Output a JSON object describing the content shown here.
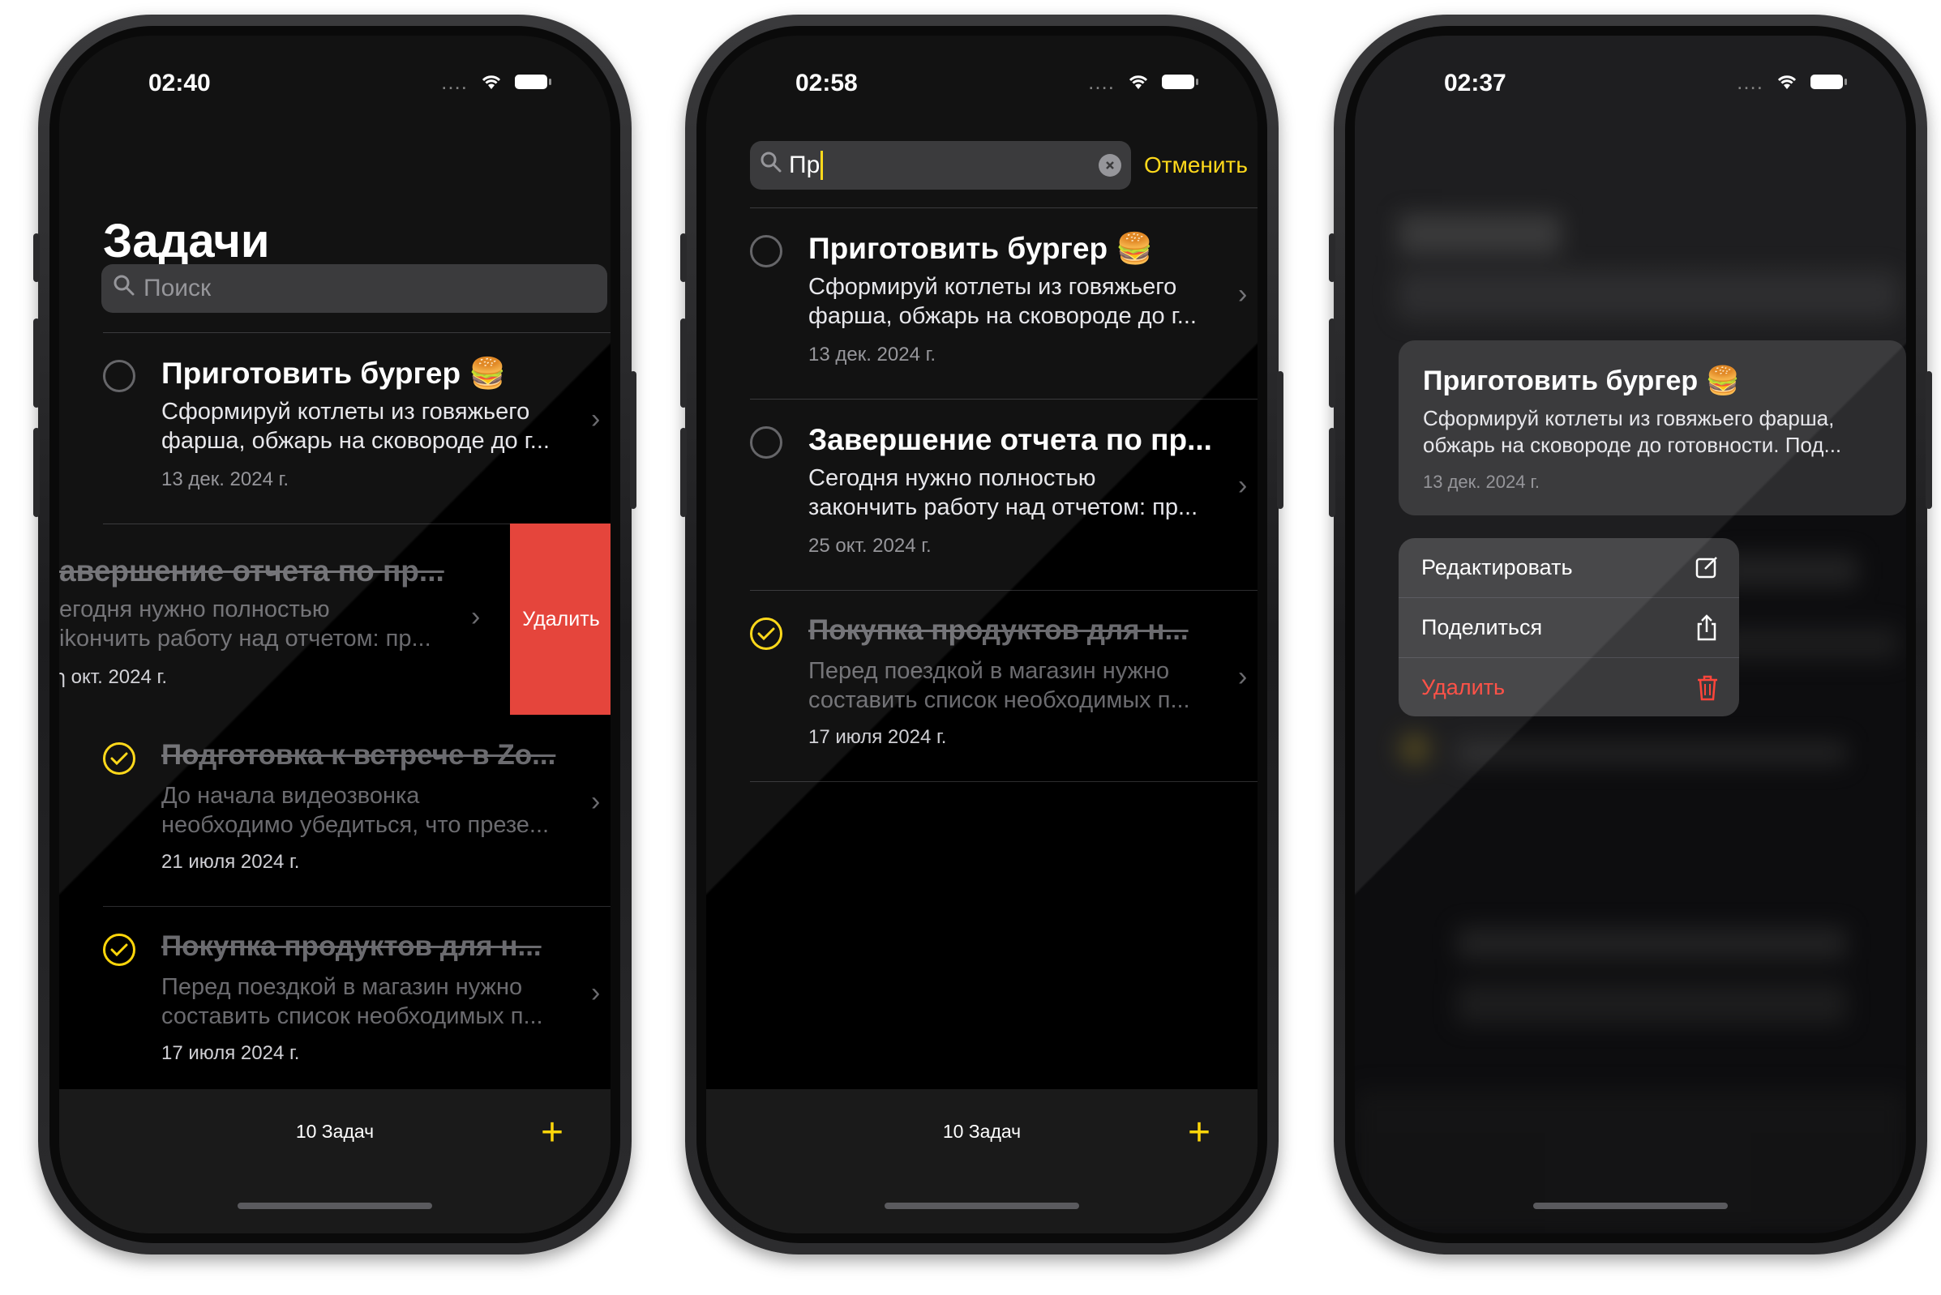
{
  "phone1": {
    "time": "02:40",
    "title": "Задачи",
    "search_placeholder": "Поиск",
    "tasks": [
      {
        "title": "Приготовить бургер 🍔",
        "desc1": "Сформируй котлеты из говяжьего",
        "desc2": "фарша, обжарь на сковороде до г...",
        "date": "13 дек. 2024 г."
      },
      {
        "title": "авершение отчета по пр...",
        "desc1": "егодня нужно полностью",
        "desc2": "ikончить работу над отчетом: пр...",
        "date": "ɿ окт. 2024 г.",
        "delete": "Удалить"
      },
      {
        "title": "Подготовка к встрече в Zo...",
        "desc1": "До начала видеозвонка",
        "desc2": "необходимо убедиться, что презе...",
        "date": "21 июля 2024 г."
      },
      {
        "title": "Покупка продуктов для н...",
        "desc1": "Перед поездкой в магазин нужно",
        "desc2": "составить список необходимых п...",
        "date": "17 июля 2024 г."
      }
    ],
    "count": "10 Задач"
  },
  "phone2": {
    "time": "02:58",
    "search_value": "Пр",
    "cancel": "Отменить",
    "tasks": [
      {
        "title": "Приготовить бургер 🍔",
        "desc1": "Сформируй котлеты из говяжьего",
        "desc2": "фарша, обжарь на сковороде до г...",
        "date": "13 дек. 2024 г."
      },
      {
        "title": "Завершение отчета по пр...",
        "desc1": "Сегодня нужно полностью",
        "desc2": "закончить работу над отчетом: пр...",
        "date": "25 окт. 2024 г."
      },
      {
        "title": "Покупка продуктов для н...",
        "desc1": "Перед поездкой в магазин нужно",
        "desc2": "составить список необходимых п...",
        "date": "17 июля 2024 г."
      }
    ],
    "count": "10 Задач"
  },
  "phone3": {
    "time": "02:37",
    "preview": {
      "title": "Приготовить бургер 🍔",
      "desc1": "Сформируй котлеты из говяжьего фарша,",
      "desc2": "обжарь на сковороде до готовности. Под...",
      "date": "13 дек. 2024 г."
    },
    "menu": {
      "edit": "Редактировать",
      "share": "Поделиться",
      "delete": "Удалить"
    }
  },
  "colors": {
    "accent": "#ffd60a",
    "destructive": "#e5453c",
    "background": "#000000"
  }
}
